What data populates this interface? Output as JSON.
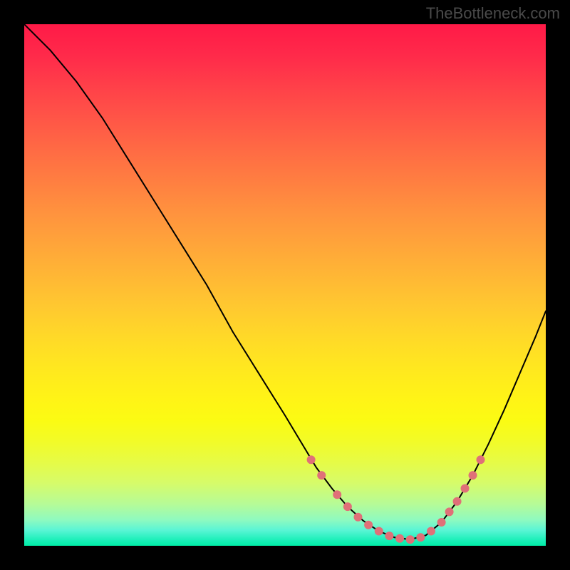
{
  "watermark": "TheBottleneck.com",
  "chart_data": {
    "type": "line",
    "title": "",
    "xlabel": "",
    "ylabel": "",
    "xlim": [
      0,
      100
    ],
    "ylim": [
      0,
      100
    ],
    "grid": false,
    "legend": false,
    "series": [
      {
        "name": "bottleneck-curve",
        "x": [
          0,
          5,
          10,
          15,
          20,
          25,
          30,
          35,
          40,
          45,
          50,
          53,
          56,
          59,
          62,
          65,
          68,
          71,
          74,
          77,
          80,
          83,
          86,
          89,
          92,
          95,
          98,
          100
        ],
        "y": [
          100,
          95,
          89,
          82,
          74,
          66,
          58,
          50,
          41,
          33,
          25,
          20,
          15,
          11,
          7.5,
          4.8,
          2.8,
          1.6,
          1.2,
          2.0,
          4.5,
          8.5,
          13.5,
          19.5,
          26,
          33,
          40,
          45
        ],
        "color": "#000000",
        "stroke_width": 2
      }
    ],
    "markers": {
      "name": "highlighted-points",
      "color": "#e07078",
      "radius": 6,
      "points": [
        {
          "x": 55,
          "y": 16.5
        },
        {
          "x": 57,
          "y": 13.5
        },
        {
          "x": 60,
          "y": 9.8
        },
        {
          "x": 62,
          "y": 7.5
        },
        {
          "x": 64,
          "y": 5.5
        },
        {
          "x": 66,
          "y": 4.0
        },
        {
          "x": 68,
          "y": 2.8
        },
        {
          "x": 70,
          "y": 1.9
        },
        {
          "x": 72,
          "y": 1.4
        },
        {
          "x": 74,
          "y": 1.2
        },
        {
          "x": 76,
          "y": 1.6
        },
        {
          "x": 78,
          "y": 2.8
        },
        {
          "x": 80,
          "y": 4.5
        },
        {
          "x": 81.5,
          "y": 6.5
        },
        {
          "x": 83,
          "y": 8.5
        },
        {
          "x": 84.5,
          "y": 11.0
        },
        {
          "x": 86,
          "y": 13.5
        },
        {
          "x": 87.5,
          "y": 16.5
        }
      ]
    }
  }
}
